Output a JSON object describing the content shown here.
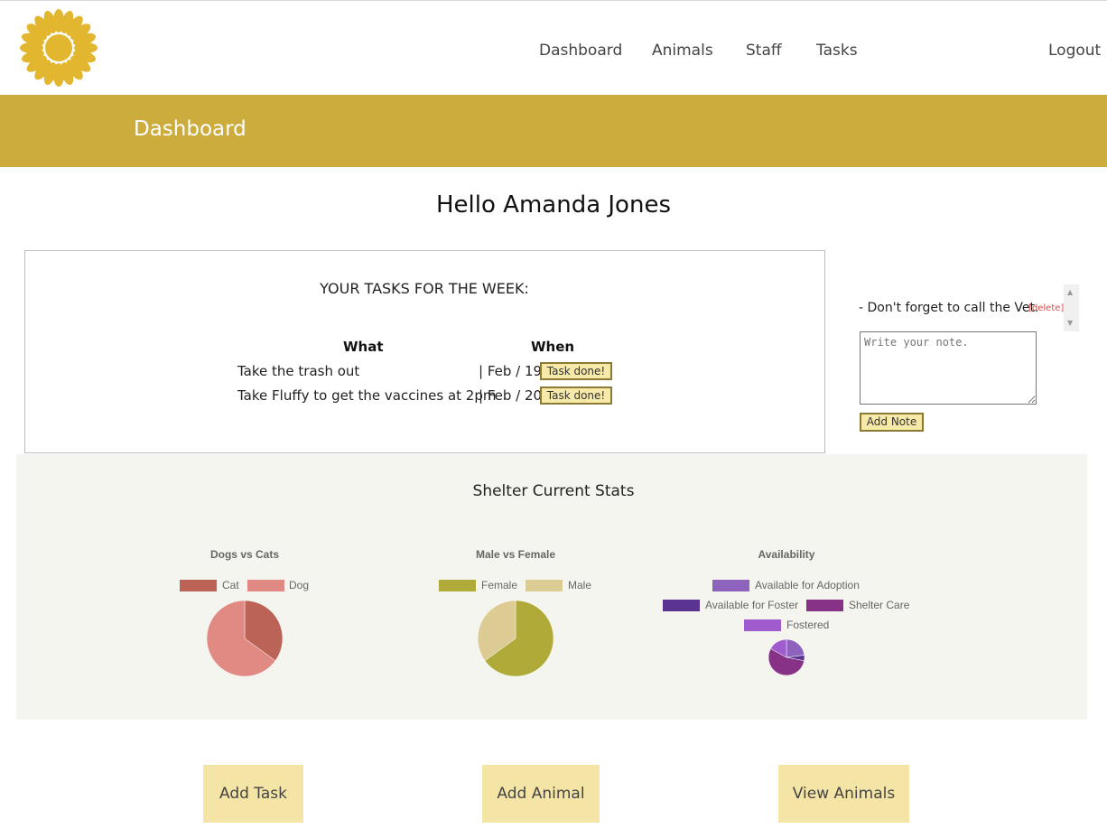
{
  "nav": {
    "items": [
      "Dashboard",
      "Animals",
      "Staff",
      "Tasks"
    ],
    "logout": "Logout"
  },
  "banner": {
    "title": "Dashboard"
  },
  "greeting": "Hello Amanda Jones",
  "tasks": {
    "title": "YOUR TASKS FOR THE WEEK:",
    "headers": {
      "what": "What",
      "when": "When"
    },
    "rows": [
      {
        "what": "Take the trash out",
        "when": "| Feb / 19",
        "button": "Task done!"
      },
      {
        "what": "Take Fluffy to get the vaccines at 2pm",
        "when": "| Feb / 20",
        "button": "Task done!"
      }
    ]
  },
  "notes": {
    "items": [
      {
        "text": "- Don't forget to call the Vet.",
        "delete": "[delete]"
      }
    ],
    "placeholder": "Write your note.",
    "add_button": "Add Note"
  },
  "stats": {
    "title": "Shelter Current Stats"
  },
  "colors": {
    "banner": "#cbac3c",
    "button_bg": "#f4e5a6",
    "stats_bg": "#f5f5ef"
  },
  "chart_data": [
    {
      "type": "pie",
      "title": "Dogs vs Cats",
      "labels": [
        "Cat",
        "Dog"
      ],
      "values": [
        35,
        65
      ],
      "colors": [
        "#bb6356",
        "#e18a84"
      ]
    },
    {
      "type": "pie",
      "title": "Male vs Female",
      "labels": [
        "Female",
        "Male"
      ],
      "values": [
        65,
        35
      ],
      "colors": [
        "#b0aa38",
        "#dccb92"
      ]
    },
    {
      "type": "pie",
      "title": "Availability",
      "labels": [
        "Available for Adoption",
        "Available for Foster",
        "Shelter Care",
        "Fostered"
      ],
      "values": [
        23,
        5,
        55,
        17
      ],
      "colors": [
        "#8e63bd",
        "#5a3490",
        "#873287",
        "#a05ccf"
      ]
    }
  ],
  "actions": {
    "add_task": "Add Task",
    "add_animal": "Add Animal",
    "view_animals": "View Animals"
  }
}
